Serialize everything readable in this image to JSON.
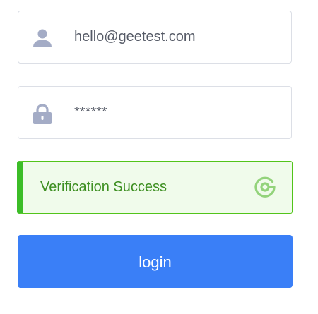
{
  "form": {
    "email": {
      "value": "hello@geetest.com",
      "icon": "user-icon"
    },
    "password": {
      "masked_value": "******",
      "icon": "lock-icon"
    },
    "captcha": {
      "status_text": "Verification Success",
      "icon": "geetest-logo-icon",
      "accent_color": "#3cbd28",
      "background_color": "#f0fbeb"
    },
    "login": {
      "label": "login",
      "color": "#3a7ff7"
    }
  },
  "colors": {
    "icon": "#a4acc6",
    "border": "#dcdfe6"
  }
}
